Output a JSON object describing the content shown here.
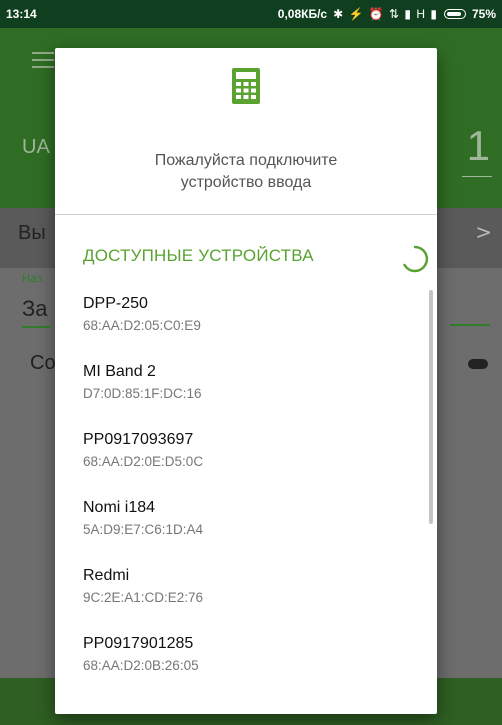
{
  "status_bar": {
    "time": "13:14",
    "net_speed": "0,08КБ/с",
    "icons": "✱ ⚡ ⏰ ⇅ ▮ H ▮",
    "battery": "75%"
  },
  "background": {
    "left_label": "UA",
    "right_number": "1",
    "left_vy": "Вы",
    "right_chevron": ">",
    "left_na": "Наз",
    "left_za": "За",
    "left_co": "Со"
  },
  "dialog": {
    "icon": "calculator-icon",
    "message_line1": "Пожалуйста подключите",
    "message_line2": "устройство ввода",
    "section_title": "ДОСТУПНЫЕ УСТРОЙСТВА",
    "devices": [
      {
        "name": "DPP-250",
        "address": "68:AA:D2:05:C0:E9"
      },
      {
        "name": "MI Band 2",
        "address": "D7:0D:85:1F:DC:16"
      },
      {
        "name": "PP0917093697",
        "address": "68:AA:D2:0E:D5:0C"
      },
      {
        "name": "Nomi i184",
        "address": "5A:D9:E7:C6:1D:A4"
      },
      {
        "name": "Redmi",
        "address": "9C:2E:A1:CD:E2:76"
      },
      {
        "name": "PP0917901285",
        "address": "68:AA:D2:0B:26:05"
      }
    ]
  },
  "colors": {
    "accent": "#5aa331",
    "app_bar": "#2f6d24",
    "status_bar": "#0f3f1e"
  }
}
